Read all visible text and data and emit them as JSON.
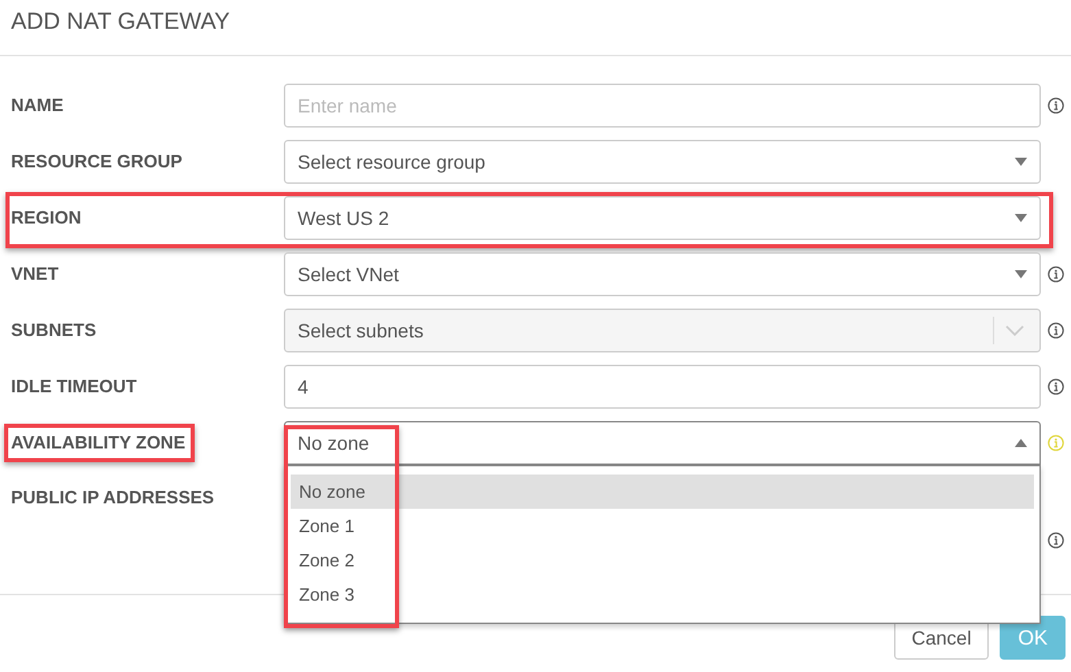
{
  "dialog": {
    "title": "ADD NAT GATEWAY"
  },
  "fields": [
    {
      "label": "NAME",
      "kind": "input",
      "placeholder": "Enter name",
      "info": true,
      "warning": false,
      "row_highlighted": false,
      "label_highlighted": false
    },
    {
      "label": "RESOURCE GROUP",
      "kind": "select",
      "value": "Select resource group",
      "info": false,
      "row_highlighted": false,
      "label_highlighted": false
    },
    {
      "label": "REGION",
      "kind": "select",
      "value": "West US 2",
      "info": false,
      "row_highlighted": true,
      "label_highlighted": false
    },
    {
      "label": "VNET",
      "kind": "select",
      "value": "Select VNet",
      "info": true,
      "warning": false,
      "row_highlighted": false,
      "label_highlighted": false
    },
    {
      "label": "SUBNETS",
      "kind": "multiselect",
      "value": "Select subnets",
      "disabled": true,
      "info": true,
      "warning": false,
      "row_highlighted": false,
      "label_highlighted": false
    },
    {
      "label": "IDLE TIMEOUT",
      "kind": "input",
      "value": "4",
      "info": true,
      "warning": false,
      "row_highlighted": false,
      "label_highlighted": false
    },
    {
      "label": "AVAILABILITY ZONE",
      "kind": "select",
      "value": "No zone",
      "expanded": true,
      "info": true,
      "warning": true,
      "row_highlighted": false,
      "label_highlighted": true,
      "options": [
        {
          "label": "No zone",
          "selected": true
        },
        {
          "label": "Zone 1",
          "selected": false
        },
        {
          "label": "Zone 2",
          "selected": false
        },
        {
          "label": "Zone 3",
          "selected": false
        }
      ],
      "options_highlighted": true
    },
    {
      "label": "PUBLIC IP ADDRESSES",
      "kind": "none",
      "info": true,
      "warning": false,
      "row_highlighted": false,
      "label_highlighted": false
    }
  ],
  "buttons": [
    {
      "label": "Cancel",
      "kind": "secondary"
    },
    {
      "label": "OK",
      "kind": "primary"
    }
  ]
}
